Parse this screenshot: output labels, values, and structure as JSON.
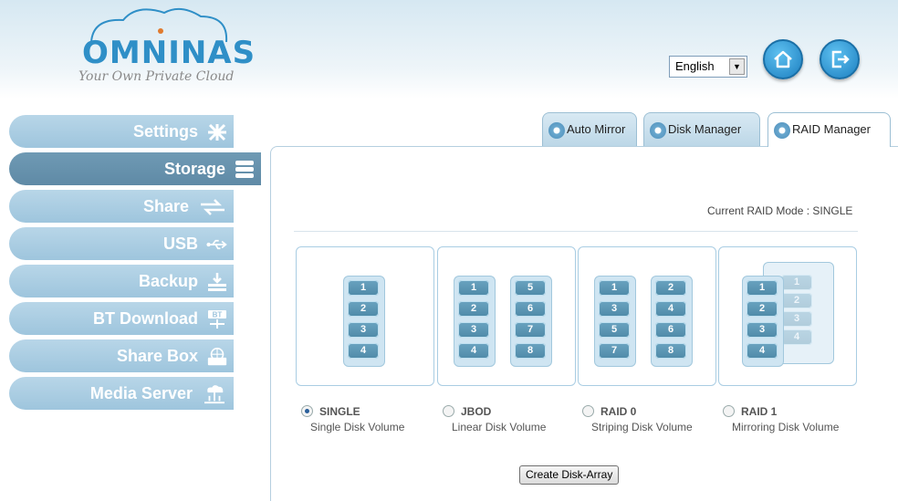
{
  "brand": {
    "name": "OMNINAS",
    "tagline": "Your Own Private Cloud",
    "color": "#2f8fc7"
  },
  "header": {
    "language": "English",
    "home_icon": "home-icon",
    "logout_icon": "logout-icon"
  },
  "sidebar": {
    "items": [
      {
        "label": "Settings",
        "icon": "settings-icon"
      },
      {
        "label": "Storage",
        "icon": "storage-icon",
        "active": true
      },
      {
        "label": "Share",
        "icon": "share-icon"
      },
      {
        "label": "USB",
        "icon": "usb-icon"
      },
      {
        "label": "Backup",
        "icon": "backup-icon"
      },
      {
        "label": "BT Download",
        "icon": "bt-download-icon"
      },
      {
        "label": "Share Box",
        "icon": "share-box-icon"
      },
      {
        "label": "Media Server",
        "icon": "media-server-icon"
      }
    ]
  },
  "tabs": [
    {
      "label": "Auto Mirror"
    },
    {
      "label": "Disk Manager"
    },
    {
      "label": "RAID Manager",
      "active": true
    }
  ],
  "raid": {
    "current_mode_text": "Current RAID Mode : SINGLE",
    "options": [
      {
        "name": "SINGLE",
        "desc": "Single Disk Volume",
        "selected": true,
        "disks": [
          "1",
          "2",
          "3",
          "4"
        ]
      },
      {
        "name": "JBOD",
        "desc": "Linear Disk Volume",
        "selected": false,
        "disks": [
          "1",
          "2",
          "3",
          "4",
          "5",
          "6",
          "7",
          "8"
        ]
      },
      {
        "name": "RAID 0",
        "desc": "Striping Disk Volume",
        "selected": false,
        "disks": [
          "1",
          "2",
          "3",
          "4",
          "5",
          "6",
          "7",
          "8"
        ]
      },
      {
        "name": "RAID 1",
        "desc": "Mirroring Disk Volume",
        "selected": false,
        "disks": [
          "1",
          "2",
          "3",
          "4"
        ]
      }
    ],
    "create_button": "Create Disk-Array"
  }
}
